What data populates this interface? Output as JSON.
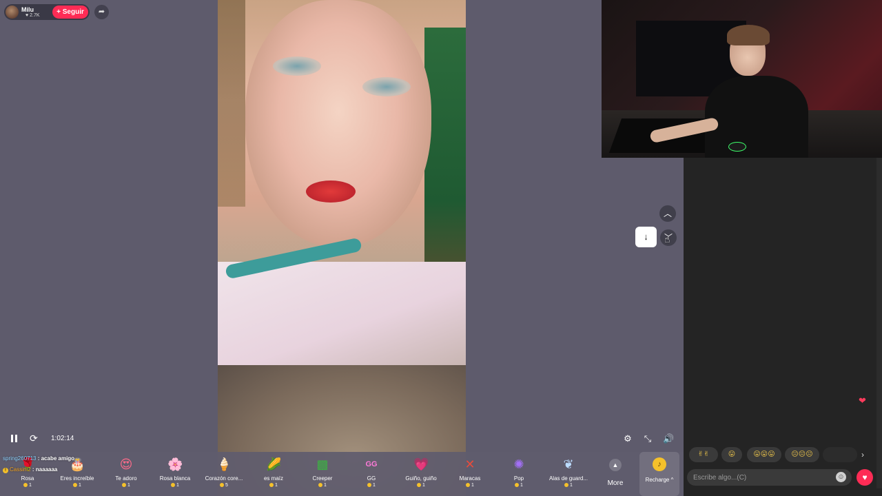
{
  "host": {
    "name": "Milu",
    "likes": "2.7K",
    "follow_label": "+ Seguir"
  },
  "controls": {
    "timer": "1:02:14"
  },
  "comments": [
    {
      "user": "spring260713",
      "text": "acabe amigo"
    },
    {
      "user": "Cassini2",
      "text": "naaaaaa"
    }
  ],
  "gifts": [
    {
      "name": "Rosa",
      "price": "1",
      "icon": "rose-icon"
    },
    {
      "name": "Eres increíble",
      "price": "1",
      "icon": "cake-icon"
    },
    {
      "name": "Te adoro",
      "price": "1",
      "icon": "heart-face-icon"
    },
    {
      "name": "Rosa blanca",
      "price": "1",
      "icon": "white-rose-icon"
    },
    {
      "name": "Corazón core...",
      "price": "5",
      "icon": "ice-cream-icon"
    },
    {
      "name": "es maíz",
      "price": "1",
      "icon": "corn-icon"
    },
    {
      "name": "Creeper",
      "price": "1",
      "icon": "creeper-icon"
    },
    {
      "name": "GG",
      "price": "1",
      "icon": "gg-icon"
    },
    {
      "name": "Guiño, guiño",
      "price": "1",
      "icon": "wink-heart-icon"
    },
    {
      "name": "Maracas",
      "price": "1",
      "icon": "maracas-icon"
    },
    {
      "name": "Pop",
      "price": "1",
      "icon": "pop-icon"
    },
    {
      "name": "Alas de guard...",
      "price": "1",
      "icon": "wings-icon"
    }
  ],
  "more_label": "More",
  "recharge_label": "Recharge ^",
  "chat": {
    "placeholder": "Escribe algo...(C)",
    "emoji_chips": [
      "✌✌",
      "😛",
      "😛😛😛",
      "😐😐😐"
    ]
  },
  "colors": {
    "accent": "#fe2c55",
    "stage_bg": "#5e5b6c",
    "chat_bg": "#242424",
    "coin": "#f5c12b"
  }
}
